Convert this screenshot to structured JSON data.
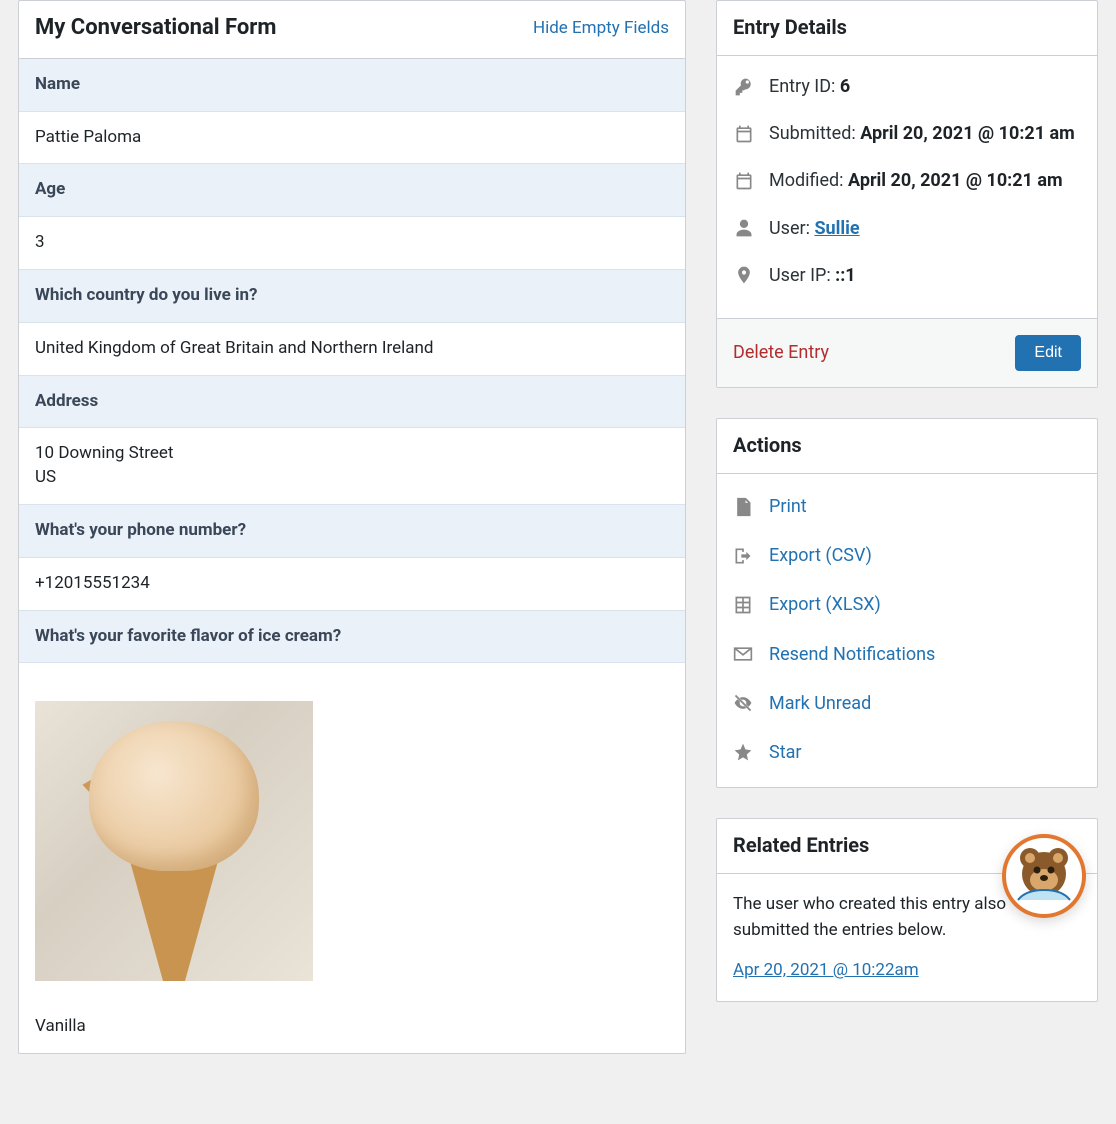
{
  "form": {
    "title": "My Conversational Form",
    "hide_link": "Hide Empty Fields",
    "fields": {
      "name_label": "Name",
      "name_value": "Pattie Paloma",
      "age_label": "Age",
      "age_value": "3",
      "country_label": "Which country do you live in?",
      "country_value": "United Kingdom of Great Britain and Northern Ireland",
      "address_label": "Address",
      "address_value": "10 Downing Street\nUS",
      "phone_label": "What's your phone number?",
      "phone_value": "+12015551234",
      "icecream_label": "What's your favorite flavor of ice cream?",
      "icecream_value": "Vanilla"
    }
  },
  "details": {
    "title": "Entry Details",
    "entry_id_label": "Entry ID: ",
    "entry_id_value": "6",
    "submitted_label": "Submitted: ",
    "submitted_value": "April 20, 2021 @ 10:21 am",
    "modified_label": "Modified: ",
    "modified_value": "April 20, 2021 @ 10:21 am",
    "user_label": "User: ",
    "user_value": "Sullie",
    "ip_label": "User IP: ",
    "ip_value": "::1",
    "delete": "Delete Entry",
    "edit": "Edit"
  },
  "actions": {
    "title": "Actions",
    "print": "Print",
    "export_csv": "Export (CSV)",
    "export_xlsx": "Export (XLSX)",
    "resend": "Resend Notifications",
    "mark_unread": "Mark Unread",
    "star": "Star"
  },
  "related": {
    "title": "Related Entries",
    "intro": "The user who created this entry also submitted the entries below.",
    "link1": "Apr 20, 2021 @ 10:22am"
  }
}
